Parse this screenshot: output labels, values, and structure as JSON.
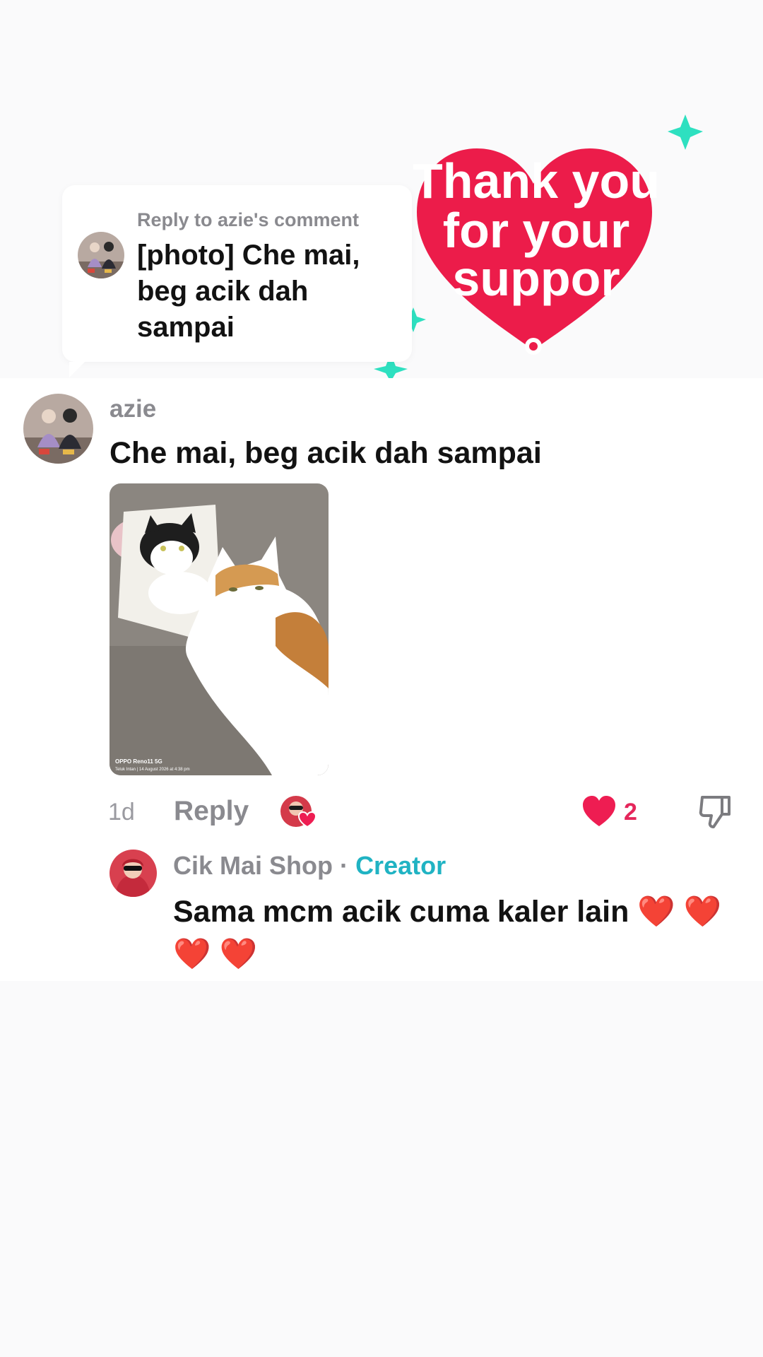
{
  "reply_card": {
    "header": "Reply to azie's comment",
    "text": "[photo] Che mai, beg acik dah sampai"
  },
  "sticker": {
    "line1": "Thank you",
    "line2": "for your",
    "line3": "suppor",
    "colors": {
      "heart": "#ec1c4a",
      "sparkle": "#2ee0c0"
    }
  },
  "comment": {
    "author": "azie",
    "text": "Che mai, beg acik dah sampai",
    "photo_caption_line1": "OPPO Reno11 5G",
    "photo_caption_line2": "Teluk Intan  |  14 August 2026 at 4:38 pm",
    "time": "1d",
    "reply_label": "Reply",
    "like_count": "2"
  },
  "creator_reply": {
    "author": "Cik Mai Shop",
    "separator": "·",
    "badge": "Creator",
    "text": "Sama mcm acik cuma kaler lain ❤️ ❤️ ❤️ ❤️"
  },
  "colors": {
    "like": "#ee1d52",
    "creator_badge": "#20b3c3",
    "muted_text": "#8a8a8f"
  }
}
